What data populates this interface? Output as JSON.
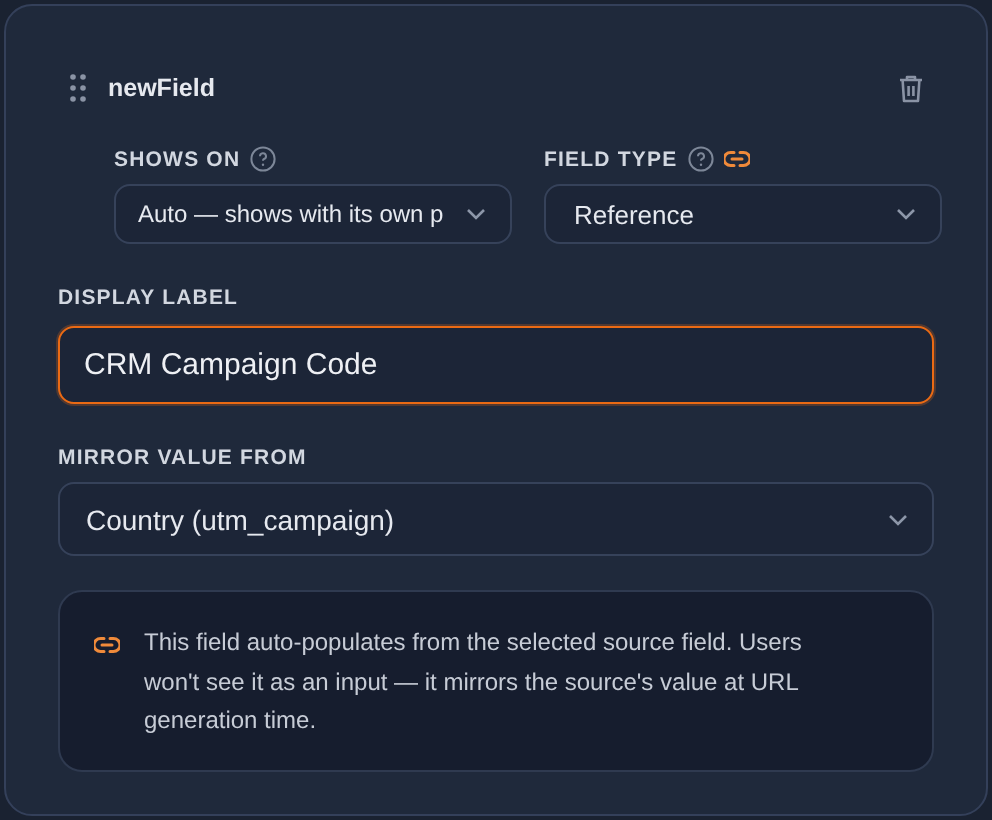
{
  "card": {
    "title": "newField",
    "shows_on": {
      "label": "SHOWS ON",
      "value": "Auto — shows with its own p"
    },
    "field_type": {
      "label": "FIELD TYPE",
      "value": "Reference",
      "linked": true
    },
    "display_label": {
      "label": "DISPLAY LABEL",
      "value": "CRM Campaign Code",
      "focused": true
    },
    "mirror_value_from": {
      "label": "MIRROR VALUE FROM",
      "value": "Country (utm_campaign)"
    },
    "info": "This field auto-populates from the selected source field. Users won't see it as an input — it mirrors the source's value at URL generation time."
  }
}
